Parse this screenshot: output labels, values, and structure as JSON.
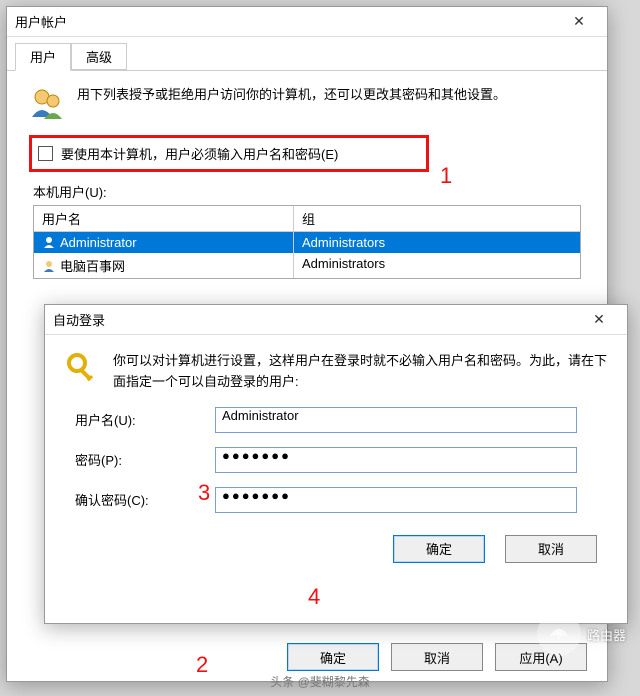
{
  "main": {
    "title": "用户帐户",
    "tabs": {
      "users": "用户",
      "advanced": "高级"
    },
    "intro": "用下列表授予或拒绝用户访问你的计算机，还可以更改其密码和其他设置。",
    "checkbox_label": "要使用本计算机，用户必须输入用户名和密码(E)",
    "local_users_label": "本机用户(U):",
    "columns": {
      "name": "用户名",
      "group": "组"
    },
    "rows": [
      {
        "name": "Administrator",
        "group": "Administrators",
        "selected": true
      },
      {
        "name": "电脑百事网",
        "group": "Administrators",
        "selected": false
      }
    ],
    "buttons": {
      "ok": "确定",
      "cancel": "取消",
      "apply": "应用(A)"
    }
  },
  "autologin": {
    "title": "自动登录",
    "intro": "你可以对计算机进行设置，这样用户在登录时就不必输入用户名和密码。为此，请在下面指定一个可以自动登录的用户:",
    "username_label": "用户名(U):",
    "username_value": "Administrator",
    "password_label": "密码(P):",
    "password_value": "●●●●●●●",
    "confirm_label": "确认密码(C):",
    "confirm_value": "●●●●●●●",
    "buttons": {
      "ok": "确定",
      "cancel": "取消"
    }
  },
  "annotations": {
    "a1": "1",
    "a2": "2",
    "a3": "3",
    "a4": "4"
  },
  "watermark": {
    "badge": "路由器",
    "attrib": "头条 @斐糊黎先森"
  }
}
